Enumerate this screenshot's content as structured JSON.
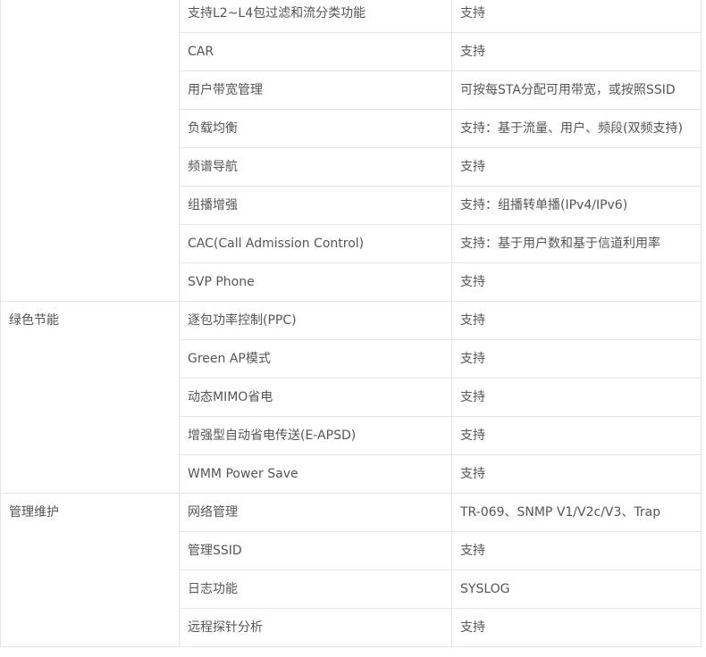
{
  "colors": {
    "text": "#555555",
    "border": "#e4e4e4",
    "background": "#ffffff"
  },
  "sections": [
    {
      "category": "",
      "rows": [
        {
          "feature": "支持L2~L4包过滤和流分类功能",
          "value": "支持"
        },
        {
          "feature": "CAR",
          "value": "支持"
        },
        {
          "feature": "用户带宽管理",
          "value": "可按每STA分配可用带宽，或按照SSID"
        },
        {
          "feature": "负载均衡",
          "value": "支持：基于流量、用户、频段(双频支持)"
        },
        {
          "feature": "频谱导航",
          "value": "支持"
        },
        {
          "feature": "组播增强",
          "value": "支持：组播转单播(IPv4/IPv6)"
        },
        {
          "feature": "CAC(Call Admission Control)",
          "value": "支持：基于用户数和基于信道利用率"
        },
        {
          "feature": "SVP Phone",
          "value": "支持"
        }
      ]
    },
    {
      "category": "绿色节能",
      "rows": [
        {
          "feature": "逐包功率控制(PPC)",
          "value": "支持"
        },
        {
          "feature": "Green AP模式",
          "value": "支持"
        },
        {
          "feature": "动态MIMO省电",
          "value": "支持"
        },
        {
          "feature": "增强型自动省电传送(E-APSD)",
          "value": "支持"
        },
        {
          "feature": "WMM Power Save",
          "value": "支持"
        }
      ]
    },
    {
      "category": "管理维护",
      "rows": [
        {
          "feature": "网络管理",
          "value": "TR-069、SNMP V1/V2c/V3、Trap"
        },
        {
          "feature": "管理SSID",
          "value": "支持"
        },
        {
          "feature": "日志功能",
          "value": "SYSLOG"
        },
        {
          "feature": "远程探针分析",
          "value": "支持"
        }
      ]
    }
  ]
}
